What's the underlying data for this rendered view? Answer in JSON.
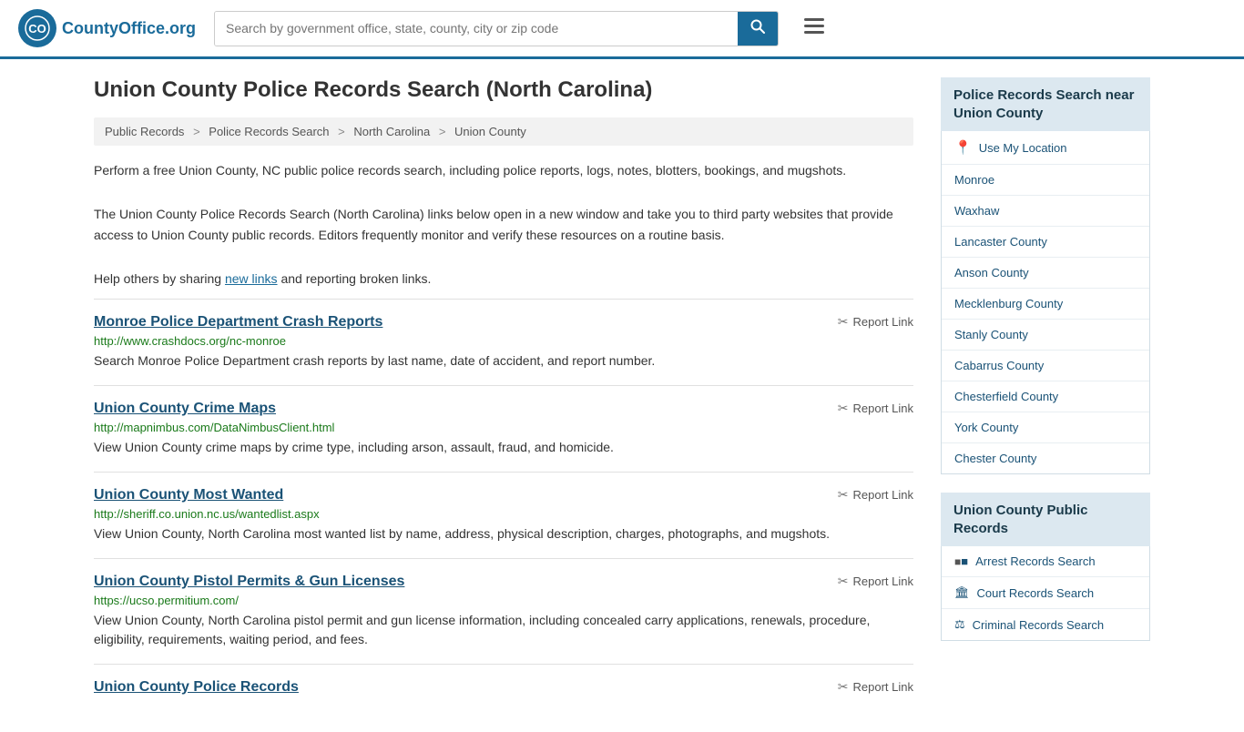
{
  "header": {
    "logo_text": "County",
    "logo_org": "Office",
    "logo_tld": ".org",
    "search_placeholder": "Search by government office, state, county, city or zip code"
  },
  "page": {
    "title": "Union County Police Records Search (North Carolina)"
  },
  "breadcrumb": {
    "items": [
      "Public Records",
      "Police Records Search",
      "North Carolina",
      "Union County"
    ]
  },
  "description": {
    "para1": "Perform a free Union County, NC public police records search, including police reports, logs, notes, blotters, bookings, and mugshots.",
    "para2": "The Union County Police Records Search (North Carolina) links below open in a new window and take you to third party websites that provide access to Union County public records. Editors frequently monitor and verify these resources on a routine basis.",
    "para3_prefix": "Help others by sharing ",
    "para3_link": "new links",
    "para3_suffix": " and reporting broken links."
  },
  "results": [
    {
      "title": "Monroe Police Department Crash Reports",
      "url": "http://www.crashdocs.org/nc-monroe",
      "desc": "Search Monroe Police Department crash reports by last name, date of accident, and report number.",
      "report_label": "Report Link"
    },
    {
      "title": "Union County Crime Maps",
      "url": "http://mapnimbus.com/DataNimbusClient.html",
      "desc": "View Union County crime maps by crime type, including arson, assault, fraud, and homicide.",
      "report_label": "Report Link"
    },
    {
      "title": "Union County Most Wanted",
      "url": "http://sheriff.co.union.nc.us/wantedlist.aspx",
      "desc": "View Union County, North Carolina most wanted list by name, address, physical description, charges, photographs, and mugshots.",
      "report_label": "Report Link"
    },
    {
      "title": "Union County Pistol Permits & Gun Licenses",
      "url": "https://ucso.permitium.com/",
      "desc": "View Union County, North Carolina pistol permit and gun license information, including concealed carry applications, renewals, procedure, eligibility, requirements, waiting period, and fees.",
      "report_label": "Report Link"
    },
    {
      "title": "Union County Police Records",
      "url": "",
      "desc": "",
      "report_label": "Report Link"
    }
  ],
  "sidebar": {
    "nearby_heading": "Police Records Search near Union County",
    "use_my_location": "Use My Location",
    "nearby_links": [
      "Monroe",
      "Waxhaw",
      "Lancaster County",
      "Anson County",
      "Mecklenburg County",
      "Stanly County",
      "Cabarrus County",
      "Chesterfield County",
      "York County",
      "Chester County"
    ],
    "public_records_heading": "Union County Public Records",
    "public_records_links": [
      {
        "label": "Arrest Records Search",
        "icon": "arrest"
      },
      {
        "label": "Court Records Search",
        "icon": "court"
      },
      {
        "label": "Criminal Records Search",
        "icon": "criminal"
      }
    ]
  }
}
